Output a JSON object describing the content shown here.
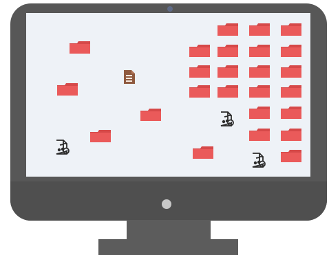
{
  "colors": {
    "bezel": "#575757",
    "chin": "#4f4f4f",
    "screen": "#eef2f7",
    "folder": "#ea5a5a",
    "folder_tab": "#d64949",
    "document": "#8f5a3f",
    "document_light": "#b57a5c",
    "music": "#2a2a2a",
    "power": "#c8c8c8",
    "camera": "#5f6b87",
    "stand": "#5c5c5c"
  },
  "icons": {
    "folder": "folder-icon",
    "document": "document-icon",
    "music": "music-file-icon"
  }
}
